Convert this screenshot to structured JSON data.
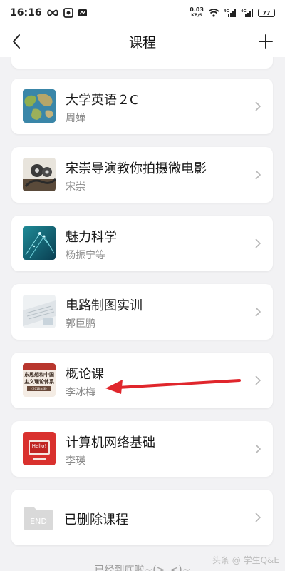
{
  "status_bar": {
    "time": "16:16",
    "net_speed_value": "0.03",
    "net_speed_unit": "KB/S",
    "battery": "77"
  },
  "nav": {
    "title": "课程",
    "back_icon": "chevron-left-icon",
    "add_icon": "plus-icon"
  },
  "courses": [
    {
      "title": "大学英语２C",
      "teacher": "周婵",
      "thumb": "world-map"
    },
    {
      "title": "宋崇导演教你拍摄微电影",
      "teacher": "宋崇",
      "thumb": "film-reel"
    },
    {
      "title": "魅力科学",
      "teacher": "杨振宁等",
      "thumb": "science-teal"
    },
    {
      "title": "电路制图实训",
      "teacher": "郭臣鹏",
      "thumb": "keyboard-desk"
    },
    {
      "title": "概论课",
      "teacher": "李冰梅",
      "thumb": "book-cover"
    },
    {
      "title": "计算机网络基础",
      "teacher": "李瑛",
      "thumb": "hello-screen"
    }
  ],
  "book_cover_text": {
    "line1": "东思想和中国",
    "line2": "主义理论体系",
    "line3": "（2018年版）"
  },
  "hello_text": "Hello!",
  "deleted": {
    "title": "已删除课程",
    "folder_label": "END"
  },
  "footer_text": "已经到底啦~(>_<)~",
  "watermark": "头条 @ 学生Q&E",
  "colors": {
    "background": "#f2f2f4",
    "card": "#ffffff",
    "arrow": "#e0262c",
    "secondary_text": "#8a8a8a"
  }
}
